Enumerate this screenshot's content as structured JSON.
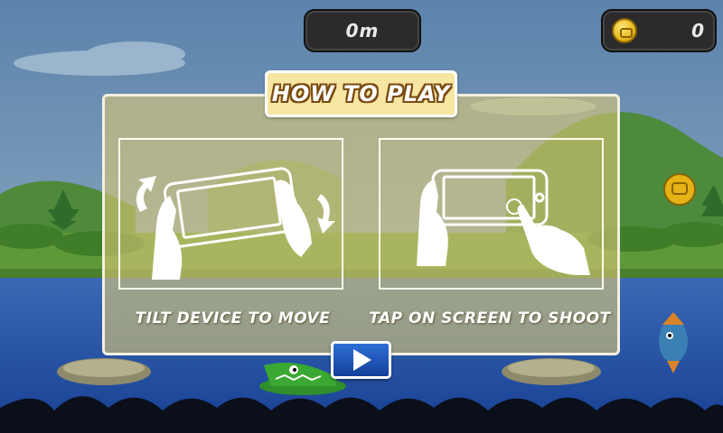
{
  "hud": {
    "distance": "0m",
    "coins": "0",
    "coin_icon": "coin-icon"
  },
  "dialog": {
    "title": "HOW TO PLAY",
    "tilt_caption": "TILT DEVICE TO MOVE",
    "tap_caption": "TAP ON SCREEN TO SHOOT",
    "tilt_icon": "tilt-device-icon",
    "tap_icon": "tap-screen-icon",
    "play_icon": "play-icon"
  },
  "colors": {
    "sky": "#5f86ad",
    "water": "#1f4fa8",
    "panel": "#d8c676",
    "title_bg": "#f6e6a2",
    "play_button": "#1f55c0",
    "hud_bg": "#2b2b2b"
  }
}
